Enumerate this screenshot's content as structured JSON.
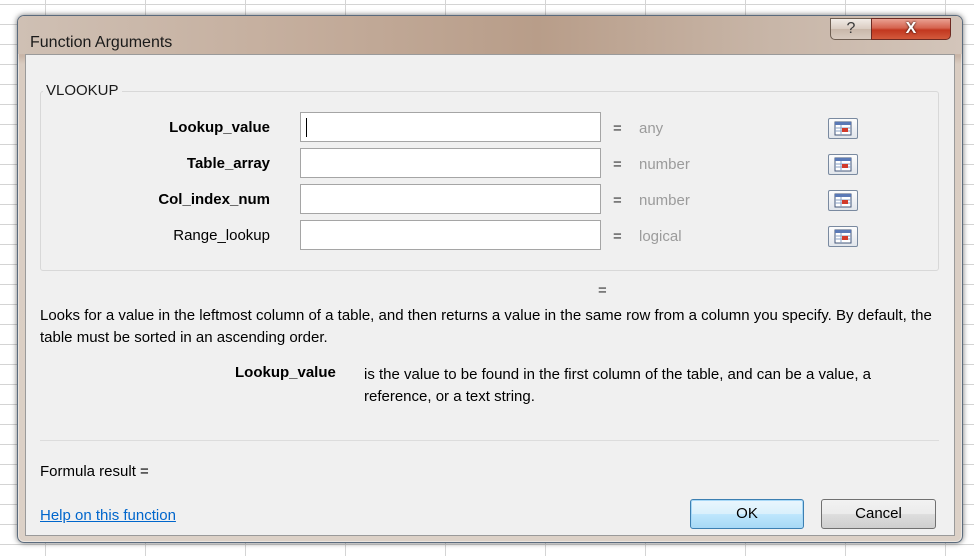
{
  "window": {
    "title": "Function Arguments",
    "help_glyph": "?",
    "close_glyph": "X"
  },
  "group": {
    "label": "VLOOKUP"
  },
  "arguments": [
    {
      "label": "Lookup_value",
      "value": "",
      "result": "any"
    },
    {
      "label": "Table_array",
      "value": "",
      "result": "number"
    },
    {
      "label": "Col_index_num",
      "value": "",
      "result": "number"
    },
    {
      "label": "Range_lookup",
      "value": "",
      "result": "logical"
    }
  ],
  "equals_sign": "=",
  "description": "Looks for a value in the leftmost column of a table, and then returns a value in the same row from a column you specify. By default, the table must be sorted in an ascending order.",
  "arg_help": {
    "label": "Lookup_value",
    "text": "is the value to be found in the first column of the table, and can be a value, a reference, or a text string."
  },
  "formula_result_label": "Formula result =",
  "help_link": "Help on this function",
  "buttons": {
    "ok": "OK",
    "cancel": "Cancel"
  },
  "icons": {
    "help": "question-icon",
    "close": "close-icon",
    "ref": "range-selector-icon"
  },
  "colors": {
    "link": "#0066cc",
    "hint_text": "#9b9b9b",
    "close_button": "#c2371f"
  }
}
